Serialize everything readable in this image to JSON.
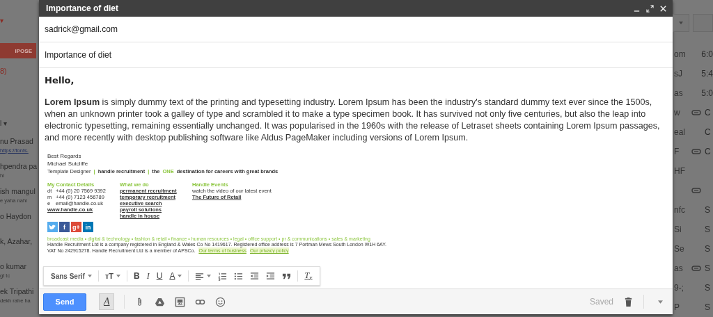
{
  "background_left": {
    "caret": "▾",
    "compose_button": "IPOSE",
    "count": "8)",
    "label": "l",
    "label_caret": "▾",
    "threads": [
      {
        "sender": "nu Prasad",
        "snippet": "https://fonts.",
        "snippet_link": true
      },
      {
        "sender": "hpendra pa",
        "snippet": "hi",
        "snippet_link": false
      },
      {
        "sender": "ish mangul",
        "snippet": "e yaha nahi",
        "snippet_link": false
      },
      {
        "sender": "o Haydon"
      },
      {
        "sender": "k, Azahar,"
      },
      {
        "sender": "o kumar",
        "snippet": "gt tc",
        "snippet_link": false
      },
      {
        "sender": "ek Tripathi",
        "snippet": "dekh rahe ha",
        "snippet_link": false
      }
    ]
  },
  "compose": {
    "title": "Importance of diet",
    "to": "sadrick@gmail.com",
    "subject": "Importance of diet",
    "greeting": "Hello,",
    "paragraph": "**Lorem Ipsum** is simply dummy text of the printing and typesetting industry. Lorem Ipsum has been the industry's standard dummy text ever since the 1500s, when an unknown printer took a galley of type and scrambled it to make a type specimen book. It has survived not only five centuries, but also the leap into electronic typesetting, remaining essentially unchanged. It was popularised in the 1960s with the release of Letraset sheets containing Lorem Ipsum passages, and more recently with desktop publishing software like Aldus PageMaker including versions of Lorem Ipsum.",
    "signature": {
      "regards": "Best Regards",
      "name": "Michael Sutcliffe",
      "tagline": [
        {
          "text": "Template Designer",
          "kind": "plain"
        },
        {
          "text": "|",
          "kind": "separator"
        },
        {
          "text": "handle recruitment",
          "kind": "bold"
        },
        {
          "text": "|",
          "kind": "separator"
        },
        {
          "text": "the",
          "kind": "bold"
        },
        {
          "text": "ONE",
          "kind": "accent"
        },
        {
          "text": "destination for careers with great brands",
          "kind": "bold"
        }
      ],
      "contact": {
        "heading": "My Contact Details",
        "rows": [
          {
            "label": "dt",
            "value": "+44 (0) 20 7569 9392"
          },
          {
            "label": "m",
            "value": "+44 (0) 7123 456789"
          },
          {
            "label": "e",
            "value": "email@handle.co.uk"
          }
        ],
        "website": "www.handle.co.uk"
      },
      "services": {
        "heading": "What we do",
        "links": [
          "permanent recruitment",
          "temporary recruitment",
          "executive search",
          "payroll solutions",
          "handle in house"
        ]
      },
      "events": {
        "heading": "Handle Events",
        "text": "watch the video of our latest event",
        "link": "The Future of Retail"
      },
      "social": [
        {
          "kind": "bird",
          "color": "#55acee"
        },
        {
          "kind": "letter",
          "glyph": "f",
          "color": "#3b5998"
        },
        {
          "kind": "letter",
          "glyph": "g+",
          "color": "#dd4b39"
        },
        {
          "kind": "letter",
          "glyph": "in",
          "color": "#0077b5"
        }
      ],
      "sectors": "broadcast media • digital & technology • fashion & retail • finance • human resources • legal • office support • pr & communications • sales & marketing",
      "legal": "Handle Recruitment Ltd is a company registered in England & Wales Co No 1419617. Registered office address is 7 Portman Mews South London W1H 6AY.",
      "vat": "VAT No 242915278. Handle Recruitment Ltd is a member of APSCo.",
      "legal_links": [
        "Our terms of business",
        "Our privacy policy"
      ]
    },
    "format_toolbar": {
      "groups": [
        [
          {
            "kind": "font",
            "label": "Sans Serif"
          }
        ],
        [
          {
            "kind": "size",
            "label": "ᴛT"
          }
        ],
        [
          {
            "kind": "bold",
            "label": "B"
          },
          {
            "kind": "italic",
            "label": "I"
          },
          {
            "kind": "underline",
            "label": "U"
          },
          {
            "kind": "color",
            "label": "A"
          }
        ],
        [
          {
            "kind": "align"
          },
          {
            "kind": "numbered"
          },
          {
            "kind": "bulleted"
          },
          {
            "kind": "outdent"
          },
          {
            "kind": "indent"
          },
          {
            "kind": "quote"
          }
        ],
        [
          {
            "kind": "clear",
            "label": "T$_{x}$"
          }
        ]
      ]
    },
    "footer": {
      "send": "Send",
      "tools": [
        {
          "kind": "format",
          "label": "A",
          "selected": true
        },
        {
          "kind": "attach"
        },
        {
          "kind": "drive"
        },
        {
          "kind": "photo"
        },
        {
          "kind": "link"
        },
        {
          "kind": "emoji"
        }
      ],
      "status": "Saved"
    }
  },
  "background_right": {
    "rows": [
      {
        "text": "om",
        "time": "6:0",
        "attachment": false
      },
      {
        "text": "sJ",
        "time": "5:4",
        "attachment": false
      },
      {
        "text": "as",
        "time": "5:0",
        "attachment": false
      },
      {
        "text": "w",
        "time": "C",
        "attachment": true
      },
      {
        "text": "eal",
        "time": "C",
        "attachment": false
      },
      {
        "text": "F",
        "time": "C",
        "attachment": true
      },
      {
        "text": "HF",
        "attachment": false
      },
      {
        "attachment": true
      },
      {
        "text": "nfc",
        "time": "S",
        "attachment": false
      },
      {
        "text": "Si",
        "time": "S",
        "attachment": false
      },
      {
        "text": "Se",
        "time": "S",
        "attachment": false
      },
      {
        "text": "as",
        "time": "S",
        "attachment": true
      },
      {
        "text": "9-;",
        "time": "S",
        "attachment": false
      },
      {
        "text": "P",
        "time": "S",
        "attachment": false
      }
    ]
  }
}
